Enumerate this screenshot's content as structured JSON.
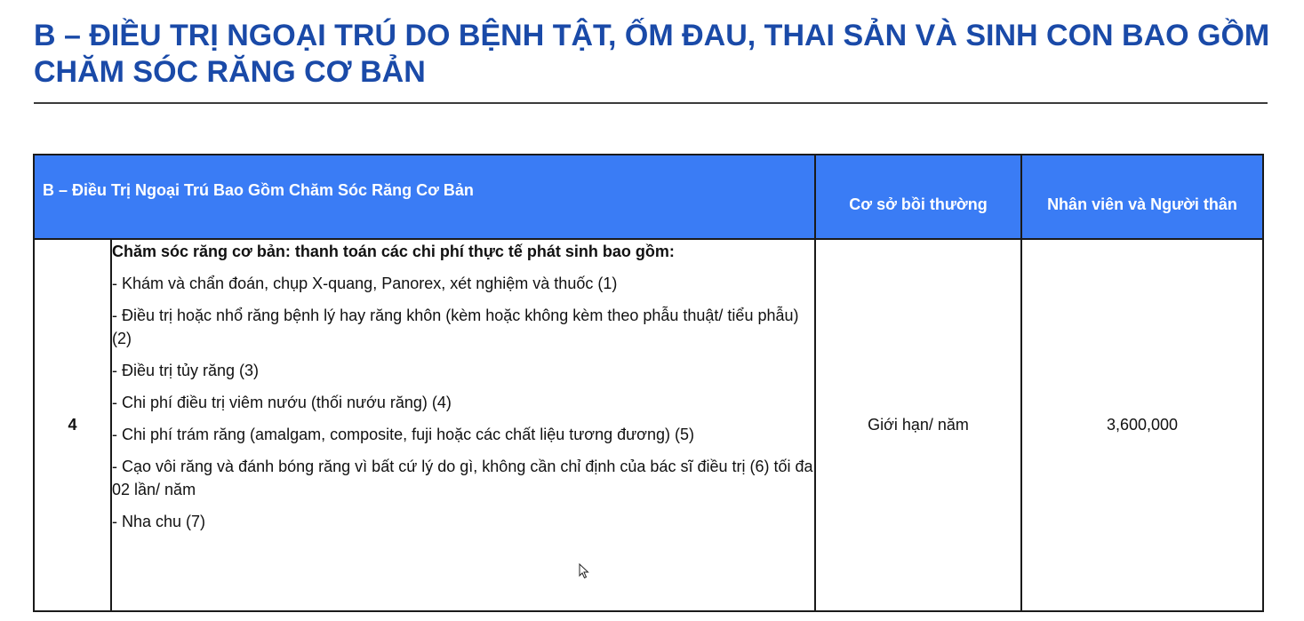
{
  "page": {
    "title": "B – ĐIỀU TRỊ NGOẠI TRÚ DO BỆNH TẬT, ỐM ĐAU, THAI SẢN VÀ SINH CON BAO GỒM CHĂM SÓC RĂNG CƠ BẢN"
  },
  "table": {
    "header": {
      "section_title": "B – Điều Trị Ngoại Trú Bao Gồm Chăm Sóc Răng Cơ Bản",
      "basis_label": "Cơ sở bồi thường",
      "amount_label": "Nhân viên và Người thân"
    },
    "row": {
      "number": "4",
      "heading": "Chăm sóc răng cơ bản: thanh toán các chi phí thực tế phát sinh bao gồm:",
      "items": [
        "-  Khám và chẩn đoán, chụp X-quang, Panorex, xét nghiệm và thuốc (1)",
        "- Điều trị hoặc nhổ răng bệnh lý hay răng khôn (kèm hoặc không kèm theo phẫu thuật/ tiểu phẫu) (2)",
        "- Điều trị tủy răng (3)",
        "- Chi phí điều trị viêm nướu (thối nướu răng) (4)",
        "- Chi phí trám răng (amalgam, composite, fuji hoặc các chất liệu tương đương) (5)",
        "- Cạo vôi răng và đánh bóng răng vì bất cứ lý do gì, không cần chỉ định của bác sĩ điều trị (6) tối đa 02 lần/ năm",
        "- Nha chu (7)"
      ],
      "basis": "Giới hạn/ năm",
      "amount": "3,600,000"
    }
  },
  "colors": {
    "title": "#1a4aa8",
    "header_bg": "#3a7cf5",
    "header_text": "#ffffff",
    "border": "#1a1a1a"
  },
  "icons": {
    "cursor": "mouse-pointer-icon"
  }
}
